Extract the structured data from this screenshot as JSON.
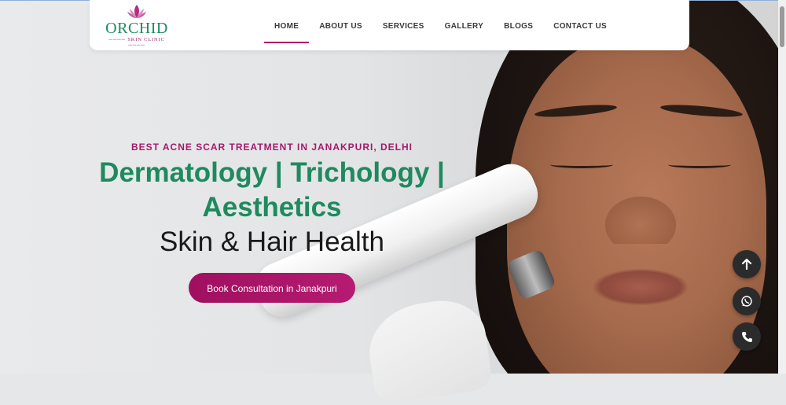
{
  "brand": {
    "name": "ORCHID",
    "tagline": "SKIN CLINIC",
    "colors": {
      "green": "#1e8a5e",
      "magenta": "#a3196b"
    }
  },
  "nav": {
    "items": [
      {
        "label": "HOME",
        "active": true
      },
      {
        "label": "ABOUT US",
        "active": false
      },
      {
        "label": "SERVICES",
        "active": false
      },
      {
        "label": "GALLERY",
        "active": false
      },
      {
        "label": "BLOGS",
        "active": false
      },
      {
        "label": "CONTACT US",
        "active": false
      }
    ]
  },
  "hero": {
    "eyebrow": "BEST ACNE SCAR TREATMENT IN JANAKPURI, DELHI",
    "headline": "Dermatology | Trichology | Aesthetics",
    "subline": "Skin & Hair Health",
    "cta_label": "Book Consultation in Janakpuri"
  },
  "floating_buttons": [
    {
      "icon": "arrow-up-icon"
    },
    {
      "icon": "whatsapp-icon"
    },
    {
      "icon": "phone-icon"
    }
  ]
}
